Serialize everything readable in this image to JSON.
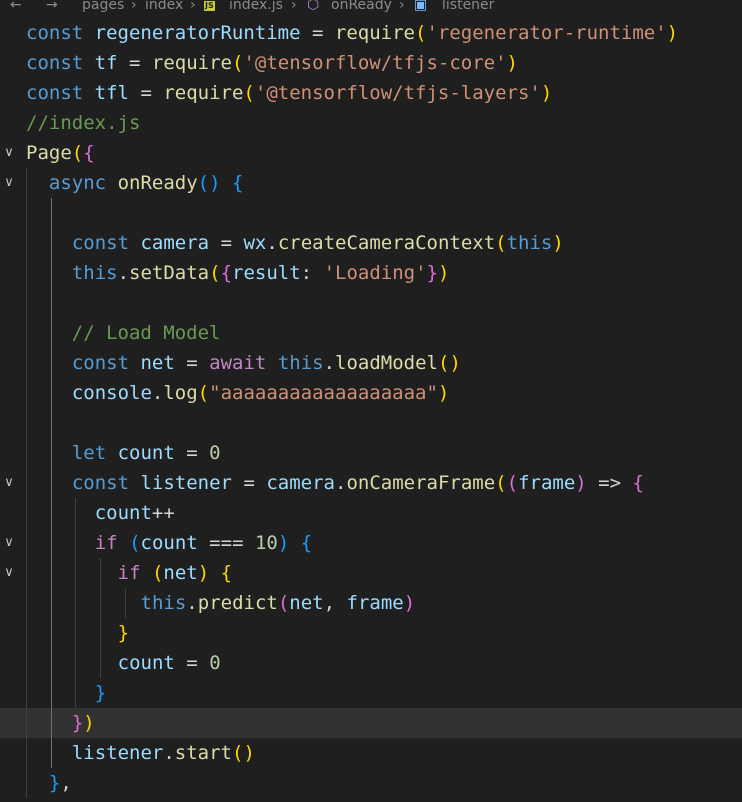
{
  "breadcrumb": {
    "back_icon": "arrow-left-icon",
    "forward_icon": "arrow-right-icon",
    "items": [
      "pages",
      "index",
      "index.js",
      "onReady",
      "listener"
    ],
    "file_badge": "JS"
  },
  "editor": {
    "language": "javascript",
    "current_line_index": 23,
    "lines": [
      "const regeneratorRuntime = require('regenerator-runtime')",
      "const tf = require('@tensorflow/tfjs-core')",
      "const tfl = require('@tensorflow/tfjs-layers')",
      "//index.js",
      "Page({",
      "  async onReady() {",
      "",
      "    const camera = wx.createCameraContext(this)",
      "    this.setData({result: 'Loading'})",
      "",
      "    // Load Model",
      "    const net = await this.loadModel()",
      "    console.log(\"aaaaaaaaaaaaaaaaaa\")",
      "",
      "    let count = 0",
      "    const listener = camera.onCameraFrame((frame) => {",
      "      count++",
      "      if (count === 10) {",
      "        if (net) {",
      "          this.predict(net, frame)",
      "        }",
      "        count = 0",
      "      }",
      "    })",
      "    listener.start()",
      "  },"
    ]
  }
}
